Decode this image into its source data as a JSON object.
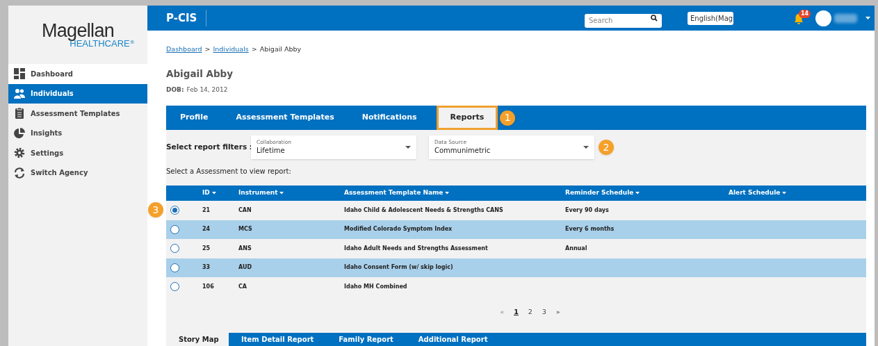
{
  "app_title": "P-CIS",
  "logo": {
    "name": "Magellan",
    "sub": "HEALTHCARE",
    "mark": "®"
  },
  "search": {
    "placeholder": "Search"
  },
  "language": {
    "value": "English(Mag"
  },
  "notifications": {
    "count": "14"
  },
  "sidebar": {
    "items": [
      {
        "label": "Dashboard",
        "selected": false
      },
      {
        "label": "Individuals",
        "selected": true
      },
      {
        "label": "Assessment Templates",
        "selected": false
      },
      {
        "label": "Insights",
        "selected": false
      },
      {
        "label": "Settings",
        "selected": false
      },
      {
        "label": "Switch Agency",
        "selected": false
      }
    ]
  },
  "breadcrumb": [
    {
      "label": "Dashboard",
      "link": true
    },
    {
      "label": "Individuals",
      "link": true
    },
    {
      "label": "Abigail Abby",
      "link": false
    }
  ],
  "breadcrumb_separator": ">",
  "person": {
    "name": "Abigail Abby",
    "dob_label": "DOB:",
    "dob": "Feb 14, 2012"
  },
  "tabs": [
    {
      "label": "Profile",
      "selected": false
    },
    {
      "label": "Assessment Templates",
      "selected": false
    },
    {
      "label": "Notifications",
      "selected": false
    },
    {
      "label": "Reports",
      "selected": true,
      "callout": "1"
    }
  ],
  "filters": {
    "label": "Select report filters :",
    "fields": [
      {
        "label": "Collaboration",
        "value": "Lifetime"
      },
      {
        "label": "Data Source",
        "value": "Communimetric",
        "callout": "2"
      }
    ]
  },
  "instruction": "Select a Assessment to view report:",
  "table": {
    "columns": [
      "ID",
      "Instrument",
      "Assessment Template Name",
      "Reminder Schedule",
      "Alert Schedule"
    ],
    "rows": [
      {
        "selected": true,
        "callout": "3",
        "cells": [
          "21",
          "CAN",
          "Idaho Child & Adolescent Needs & Strengths CANS",
          "Every 90 days"
        ]
      },
      {
        "selected": false,
        "cells": [
          "24",
          "MCS",
          "Modified Colorado Symptom Index",
          "Every 6 months"
        ]
      },
      {
        "selected": false,
        "cells": [
          "25",
          "ANS",
          "Idaho Adult Needs and Strengths Assessment",
          "Annual"
        ]
      },
      {
        "selected": false,
        "cells": [
          "33",
          "AUD",
          "Idaho Consent Form (w/ skip logic)"
        ]
      },
      {
        "selected": false,
        "cells": [
          "106",
          "CA",
          "Idaho MH Combined"
        ]
      }
    ]
  },
  "pagination": {
    "prev": "«",
    "pages": [
      {
        "label": "1",
        "selected": true
      },
      {
        "label": "2",
        "selected": false
      },
      {
        "label": "3",
        "selected": false
      }
    ],
    "next": "»"
  },
  "report_tabs": [
    {
      "label": "Story Map",
      "selected": true
    },
    {
      "label": "Item Detail Report",
      "selected": false
    },
    {
      "label": "Family Report",
      "selected": false
    },
    {
      "label": "Additional Report",
      "selected": false
    }
  ]
}
